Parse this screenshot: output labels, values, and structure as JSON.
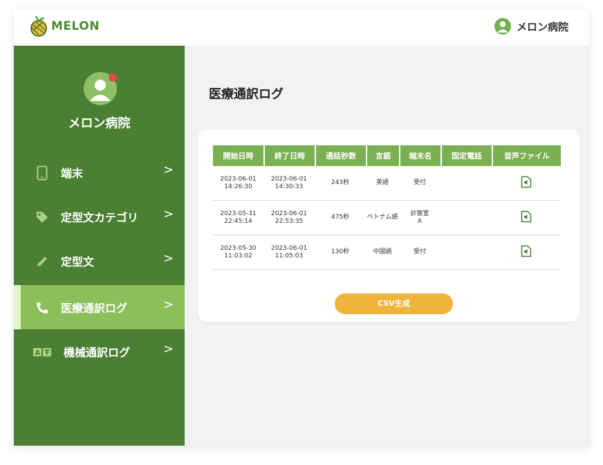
{
  "header": {
    "logo_text": "MELON",
    "user_name": "メロン病院"
  },
  "sidebar": {
    "profile_name": "メロン病院",
    "items": [
      {
        "label": "端末",
        "icon": "tablet-icon",
        "active": false
      },
      {
        "label": "定型文カテゴリ",
        "icon": "tag-icon",
        "active": false
      },
      {
        "label": "定型文",
        "icon": "pencil-icon",
        "active": false
      },
      {
        "label": "医療通訳ログ",
        "icon": "phone-icon",
        "active": true
      },
      {
        "label": "機械通訳ログ",
        "icon": "translate-icon",
        "active": false
      }
    ],
    "chevron": ">"
  },
  "main": {
    "title": "医療通訳ログ",
    "table": {
      "headers": [
        "開始日時",
        "終了日時",
        "通話秒数",
        "言語",
        "端末名",
        "固定電話",
        "音声ファイル"
      ],
      "rows": [
        {
          "start_date": "2023-06-01",
          "start_time": "14:26:30",
          "end_date": "2023-06-01",
          "end_time": "14:30:33",
          "duration": "243秒",
          "language": "英語",
          "device": "受付",
          "device_line2": "",
          "landline": ""
        },
        {
          "start_date": "2023-05-31",
          "start_time": "22:45:14",
          "end_date": "2023-06-01",
          "end_time": "22:53:35",
          "duration": "475秒",
          "language": "ベトナム語",
          "device": "診察室",
          "device_line2": "A",
          "landline": ""
        },
        {
          "start_date": "2023-05-30",
          "start_time": "11:03:02",
          "end_date": "2023-06-01",
          "end_time": "11:05:03",
          "duration": "130秒",
          "language": "中国語",
          "device": "受付",
          "device_line2": "",
          "landline": ""
        }
      ]
    },
    "csv_button": "CSV生成"
  },
  "colors": {
    "sidebar_bg": "#4a7f34",
    "active_item_bg": "#8bbf5a",
    "table_header_bg": "#7ab04f",
    "csv_button_bg": "#efb43c",
    "logo_green": "#4a8b34",
    "notification_dot": "#e24b4b"
  }
}
